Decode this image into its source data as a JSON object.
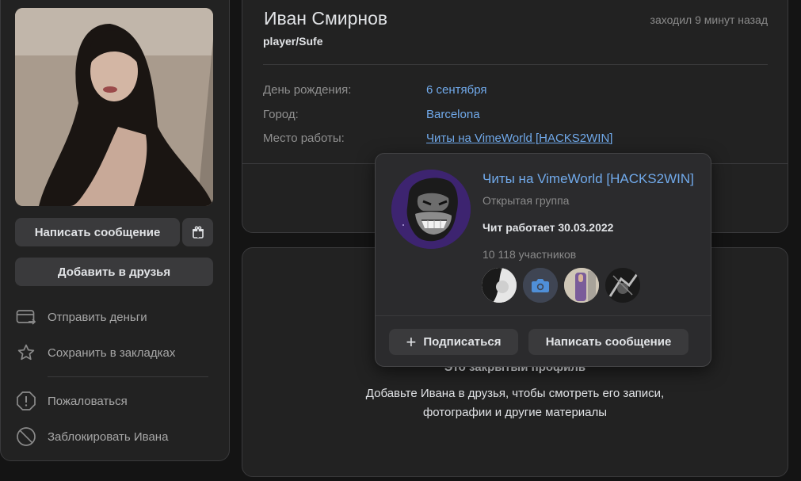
{
  "profile": {
    "name": "Иван Смирнов",
    "status": "player/Sufe",
    "last_seen": "заходил 9 минут назад",
    "info": [
      {
        "label": "День рождения:",
        "value": "6 сентября"
      },
      {
        "label": "Город:",
        "value": "Barcelona"
      },
      {
        "label": "Место работы:",
        "value": "Читы на VimeWorld [HACKS2WIN]"
      }
    ]
  },
  "actions": {
    "write_message": "Написать сообщение",
    "add_friend": "Добавить в друзья",
    "gift_icon": "gift-icon"
  },
  "menu": [
    {
      "label": "Отправить деньги",
      "icon": "money-transfer-icon"
    },
    {
      "label": "Сохранить в закладках",
      "icon": "star-icon"
    },
    {
      "label": "Пожаловаться",
      "icon": "report-icon"
    },
    {
      "label": "Заблокировать Ивана",
      "icon": "block-icon"
    }
  ],
  "closed_profile": {
    "title": "Это закрытый профиль",
    "text_line1": "Добавьте Ивана в друзья, чтобы смотреть его записи,",
    "text_line2": "фотографии и другие материалы"
  },
  "group_popup": {
    "name": "Читы на VimeWorld [HACKS2WIN]",
    "type": "Открытая группа",
    "status": "Чит работает 30.03.2022",
    "members": "10 118 участников",
    "subscribe": "Подписаться",
    "write_message": "Написать сообщение"
  },
  "colors": {
    "background": "#141414",
    "card": "#222222",
    "link": "#71aaeb",
    "button": "#3a3a3c",
    "popup": "#2b2b2d"
  }
}
